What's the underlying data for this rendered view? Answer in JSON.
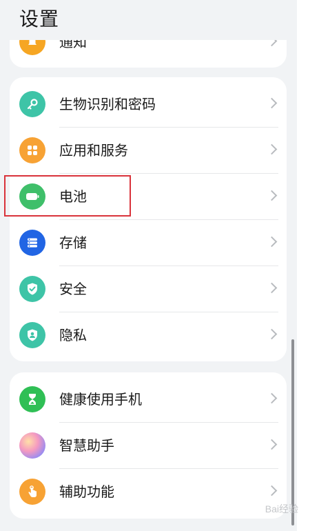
{
  "title": "设置",
  "top_card": {
    "label": "通知",
    "icon": "notification-icon",
    "icon_color": "#f6a623"
  },
  "group1": [
    {
      "label": "生物识别和密码",
      "icon": "key-icon",
      "icon_color": "#3ec4a7"
    },
    {
      "label": "应用和服务",
      "icon": "apps-grid-icon",
      "icon_color": "#f7a234"
    },
    {
      "label": "电池",
      "icon": "battery-icon",
      "icon_color": "#3fbf6a"
    },
    {
      "label": "存储",
      "icon": "storage-icon",
      "icon_color": "#2165e4"
    },
    {
      "label": "安全",
      "icon": "shield-icon",
      "icon_color": "#3ec4a7"
    },
    {
      "label": "隐私",
      "icon": "privacy-icon",
      "icon_color": "#3ec4a7"
    }
  ],
  "group2": [
    {
      "label": "健康使用手机",
      "icon": "hourglass-icon",
      "icon_color": "#2fbf55"
    },
    {
      "label": "智慧助手",
      "icon": "assistant-icon",
      "icon_color": "#b98be8"
    },
    {
      "label": "辅助功能",
      "icon": "hand-icon",
      "icon_color": "#f7a234"
    }
  ],
  "watermark": "Bai经验"
}
